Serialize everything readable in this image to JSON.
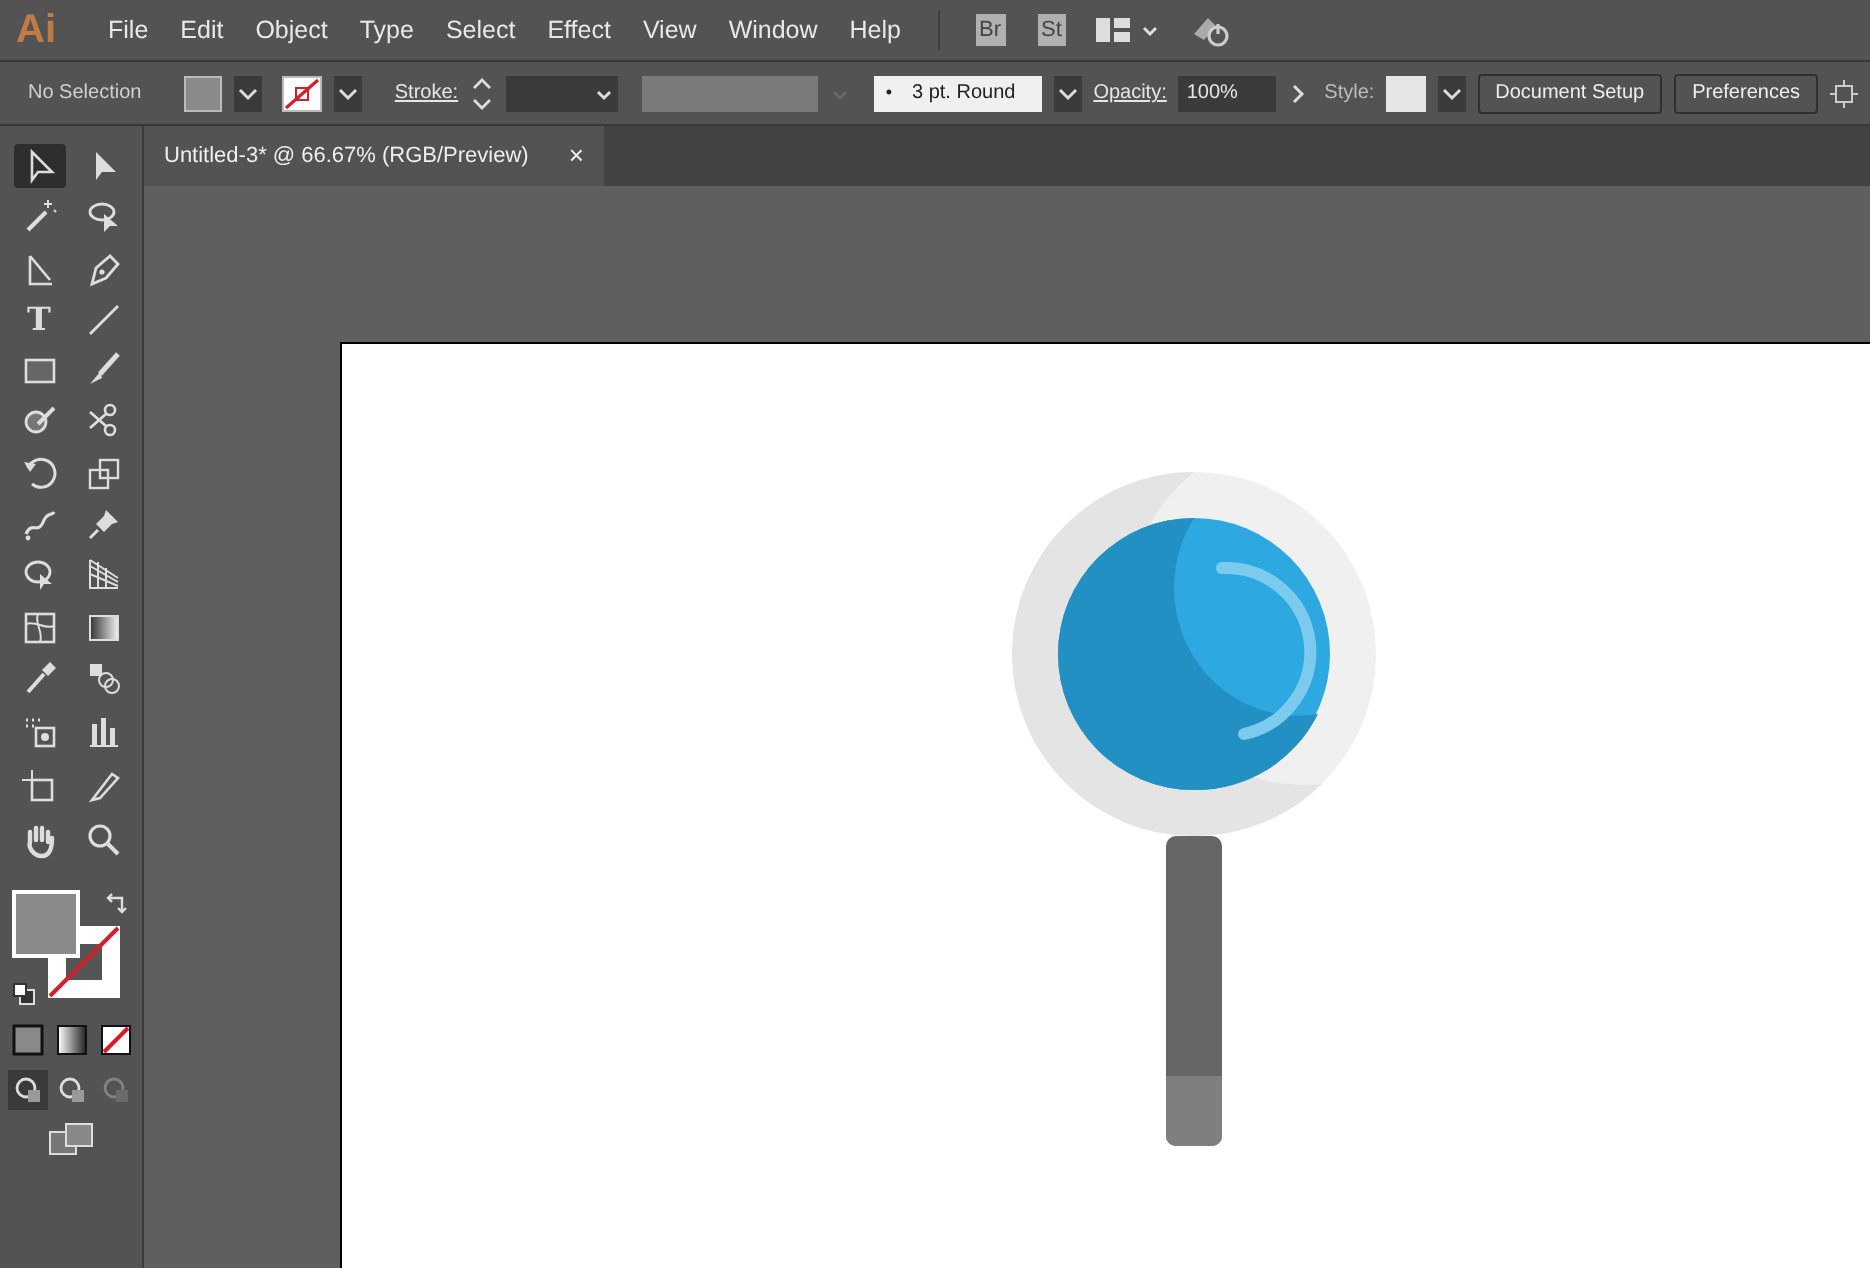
{
  "app_logo": "Ai",
  "menu": [
    "File",
    "Edit",
    "Object",
    "Type",
    "Select",
    "Effect",
    "View",
    "Window",
    "Help"
  ],
  "app_badges": [
    "Br",
    "St"
  ],
  "control_bar": {
    "selection_label": "No Selection",
    "stroke_label": "Stroke:",
    "brush": {
      "dot": "•",
      "label": "3 pt. Round"
    },
    "opacity_label": "Opacity:",
    "opacity_value": "100%",
    "style_label": "Style:",
    "buttons": [
      "Document Setup",
      "Preferences"
    ]
  },
  "document_tabs": [
    {
      "title": "Untitled-3* @ 66.67% (RGB/Preview)",
      "close": "×",
      "selected": true
    }
  ],
  "tools": [
    {
      "kind": "select",
      "selected": true
    },
    {
      "kind": "direct",
      "selected": false
    },
    {
      "kind": "wand",
      "selected": false
    },
    {
      "kind": "lasso",
      "selected": false
    },
    {
      "kind": "angle",
      "selected": false
    },
    {
      "kind": "pen",
      "selected": false
    },
    {
      "kind": "type",
      "label": "T",
      "selected": false
    },
    {
      "kind": "line",
      "selected": false
    },
    {
      "kind": "rect",
      "selected": false
    },
    {
      "kind": "brush",
      "selected": false
    },
    {
      "kind": "shaper",
      "selected": false
    },
    {
      "kind": "scissors",
      "selected": false
    },
    {
      "kind": "rotate",
      "selected": false
    },
    {
      "kind": "scale",
      "selected": false
    },
    {
      "kind": "warp",
      "selected": false
    },
    {
      "kind": "pin",
      "selected": false
    },
    {
      "kind": "builder",
      "selected": false
    },
    {
      "kind": "grid",
      "selected": false
    },
    {
      "kind": "mesh",
      "selected": false
    },
    {
      "kind": "gradient",
      "selected": false
    },
    {
      "kind": "dropper",
      "selected": false
    },
    {
      "kind": "blend",
      "selected": false
    },
    {
      "kind": "sprayer",
      "selected": false
    },
    {
      "kind": "chart",
      "selected": false
    },
    {
      "kind": "artboard",
      "selected": false
    },
    {
      "kind": "knife",
      "selected": false
    },
    {
      "kind": "hand",
      "selected": false
    },
    {
      "kind": "zoom",
      "selected": false
    }
  ],
  "draw_modes": [
    {
      "selected": true
    },
    {
      "selected": false
    },
    {
      "selected": false
    }
  ]
}
